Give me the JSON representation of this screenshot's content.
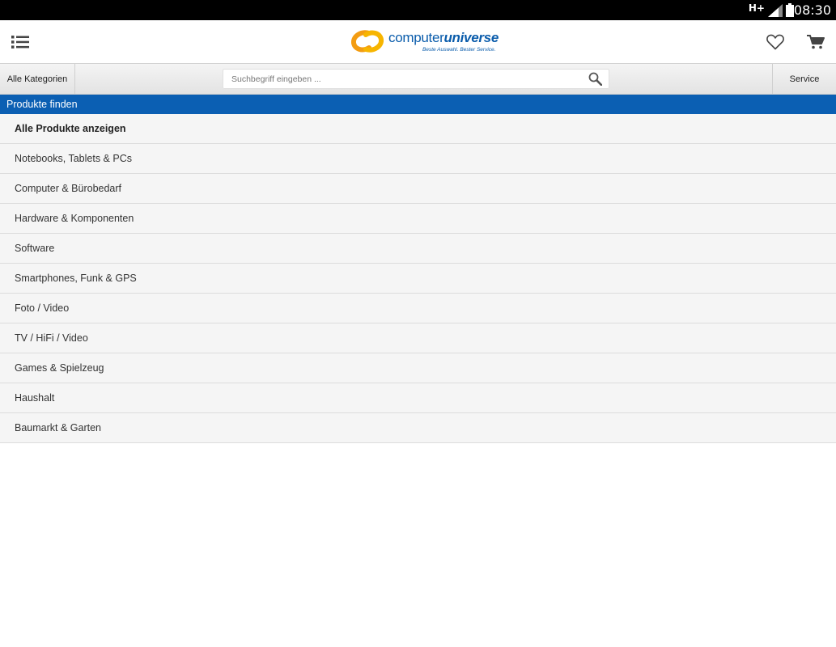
{
  "status_bar": {
    "network": "H+",
    "time": "08:30",
    "icons": [
      "signal-icon",
      "battery-icon"
    ]
  },
  "header": {
    "logo_text_light": "computer",
    "logo_text_bold": "universe",
    "logo_tagline": "Beste Auswahl. Bester Service.",
    "icons": {
      "menu": "list-menu-icon",
      "wishlist": "heart-icon",
      "cart": "cart-icon"
    },
    "brand_colors": {
      "blue": "#0a5cab",
      "orange": "#f39c12"
    }
  },
  "toolbar": {
    "categories_label": "Alle Kategorien",
    "search_placeholder": "Suchbegriff eingeben ...",
    "search_value": "",
    "service_label": "Service"
  },
  "section": {
    "title": "Produkte finden",
    "color": "#0b5fb3"
  },
  "categories": [
    "Alle Produkte anzeigen",
    "Notebooks, Tablets & PCs",
    "Computer & Bürobedarf",
    "Hardware & Komponenten",
    "Software",
    "Smartphones, Funk & GPS",
    "Foto / Video",
    "TV / HiFi / Video",
    "Games & Spielzeug",
    "Haushalt",
    "Baumarkt & Garten"
  ]
}
